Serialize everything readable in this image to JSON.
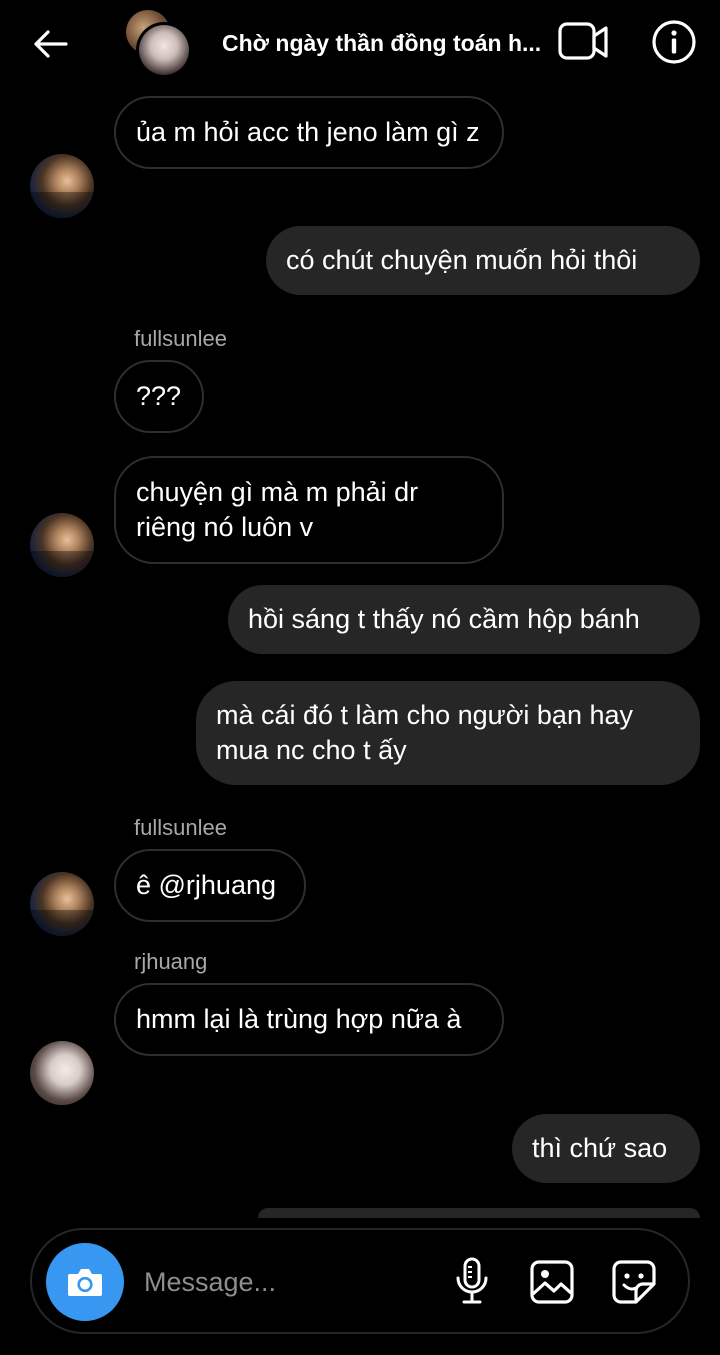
{
  "header": {
    "title": "Chờ ngày thần đồng toán h...",
    "icons": [
      "back-arrow-icon",
      "video-call-icon",
      "info-icon"
    ]
  },
  "messages": [
    {
      "sender": "",
      "text": "ủa m hỏi acc th jeno làm gì z",
      "direction": "in"
    },
    {
      "sender": "",
      "text": "có chút chuyện muốn hỏi thôi",
      "direction": "out"
    },
    {
      "sender": "fullsunlee",
      "text": "???",
      "direction": "in"
    },
    {
      "sender": "",
      "text": "chuyện gì mà m phải dr riêng nó luôn v",
      "direction": "in"
    },
    {
      "sender": "",
      "text": "hồi sáng t thấy nó cầm hộp bánh",
      "direction": "out"
    },
    {
      "sender": "",
      "text": "mà cái đó t làm cho người bạn hay mua nc cho t ấy",
      "direction": "out"
    },
    {
      "sender": "fullsunlee",
      "text": "ê @rjhuang",
      "direction": "in"
    },
    {
      "sender": "rjhuang",
      "text": "hmm lại là trùng hợp nữa à",
      "direction": "in"
    },
    {
      "sender": "",
      "text": "thì chứ sao",
      "direction": "out"
    }
  ],
  "composer": {
    "placeholder": "Message...",
    "icons": [
      "camera-icon",
      "microphone-icon",
      "gallery-icon",
      "sticker-icon"
    ],
    "accent_color": "#3897f0"
  },
  "colors": {
    "background": "#000000",
    "outgoing_bubble": "#262626",
    "incoming_border": "#2e2e2e",
    "sender_label": "#a8a8a8"
  }
}
